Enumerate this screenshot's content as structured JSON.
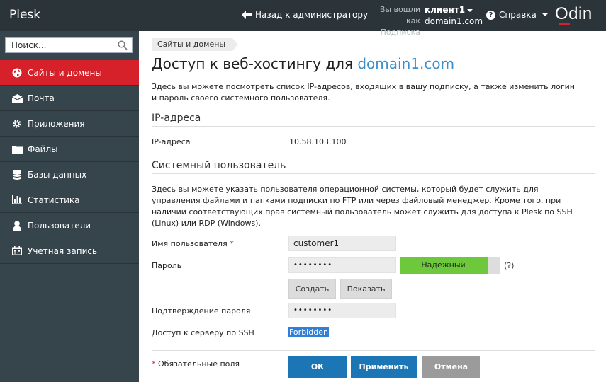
{
  "header": {
    "brand": "Plesk",
    "back_label": "Назад к администратору",
    "logged_in_label": "Вы вошли как",
    "logged_in_user": "клиент1",
    "subscription_label": "Подписка",
    "subscription_value": "domain1.com",
    "help_label": "Справка",
    "logo_text": "Odin"
  },
  "sidebar": {
    "search_placeholder": "Поиск...",
    "items": [
      {
        "label": "Сайты и домены",
        "icon": "globe-icon",
        "active": true
      },
      {
        "label": "Почта",
        "icon": "envelope-icon"
      },
      {
        "label": "Приложения",
        "icon": "gear-icon"
      },
      {
        "label": "Файлы",
        "icon": "folder-icon"
      },
      {
        "label": "Базы данных",
        "icon": "database-icon"
      },
      {
        "label": "Статистика",
        "icon": "bar-chart-icon"
      },
      {
        "label": "Пользователи",
        "icon": "user-icon"
      },
      {
        "label": "Учетная запись",
        "icon": "calendar-card-icon"
      }
    ]
  },
  "main": {
    "breadcrumb": "Сайты и домены",
    "title_prefix": "Доступ к веб-хостингу для",
    "title_domain": "domain1.com",
    "intro": "Здесь вы можете посмотреть список IP-адресов, входящих в вашу подписку, а также изменить логин и пароль своего системного пользователя.",
    "ip_section": "IP-адреса",
    "ip_label": "IP-адреса",
    "ip_value": "10.58.103.100",
    "sys_section": "Системный пользователь",
    "sys_intro": "Здесь вы можете указать пользователя операционной системы, который будет служить для управления файлами и папками подписки по FTP или через файловый менеджер. Кроме того, при наличии соответствующих прав системный пользователь может служить для доступа к Plesk по SSH (Linux) или RDP (Windows).",
    "username_label": "Имя пользователя",
    "required_mark": "*",
    "username_value": "customer1",
    "password_label": "Пароль",
    "password_value": "••••••••",
    "strength_label": "Надежный",
    "strength_level": 0.87,
    "strength_help": "(?)",
    "generate_label": "Создать",
    "show_label": "Показать",
    "confirm_label": "Подтверждение пароля",
    "confirm_value": "••••••••",
    "ssh_label": "Доступ к серверу по SSH",
    "ssh_value": "Forbidden",
    "required_note": "Обязательные поля",
    "ok_label": "ОК",
    "apply_label": "Применить",
    "cancel_label": "Отмена"
  },
  "colors": {
    "topbar": "#2b3438",
    "sidebar": "#36454c",
    "active": "#d6202a",
    "link": "#3d8fc9",
    "strength": "#6ec83c",
    "primary": "#1c76b5"
  }
}
